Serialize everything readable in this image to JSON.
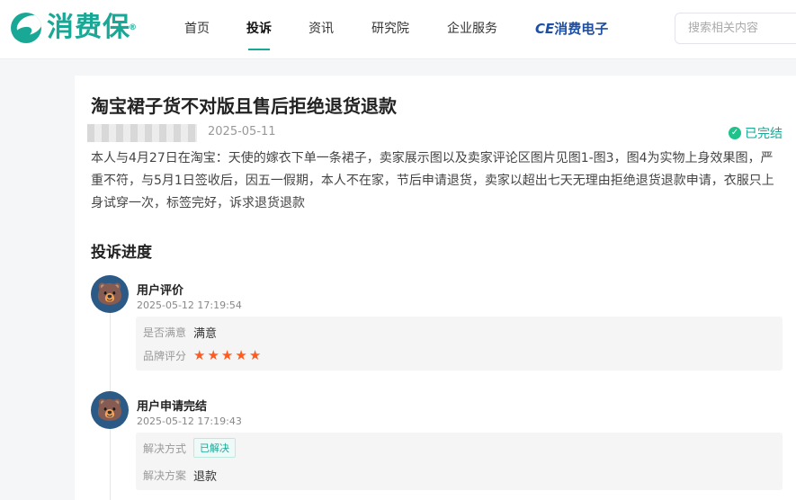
{
  "header": {
    "logo_text": "消费保",
    "logo_reg": "®",
    "nav": [
      {
        "label": "首页",
        "active": false
      },
      {
        "label": "投诉",
        "active": true
      },
      {
        "label": "资讯",
        "active": false
      },
      {
        "label": "研究院",
        "active": false
      },
      {
        "label": "企业服务",
        "active": false
      }
    ],
    "ce_prefix": "CE",
    "ce_label": "消费电子",
    "search_placeholder": "搜索相关内容"
  },
  "complaint": {
    "title": "淘宝裙子货不对版且售后拒绝退货退款",
    "date": "2025-05-11",
    "status": "已完结",
    "description": "本人与4月27日在淘宝：天使的嫁衣下单一条裙子，卖家展示图以及卖家评论区图片见图1-图3，图4为实物上身效果图，严重不符，与5月1日签收后，因五一假期，本人不在家，节后申请退货，卖家以超出七天无理由拒绝退货退款申请，衣服只上身试穿一次，标签完好，诉求退货退款"
  },
  "progress": {
    "title": "投诉进度",
    "events": [
      {
        "name": "用户评价",
        "time": "2025-05-12 17:19:54",
        "satisfaction_label": "是否满意",
        "satisfaction_value": "满意",
        "rating_label": "品牌评分",
        "rating": 5
      },
      {
        "name": "用户申请完结",
        "time": "2025-05-12 17:19:43",
        "method_label": "解决方式",
        "method_value": "已解决",
        "plan_label": "解决方案",
        "plan_value": "退款"
      }
    ]
  },
  "colors": {
    "brand": "#1aa896",
    "star": "#ff5a1f",
    "ce_blue": "#1d4fa3"
  }
}
